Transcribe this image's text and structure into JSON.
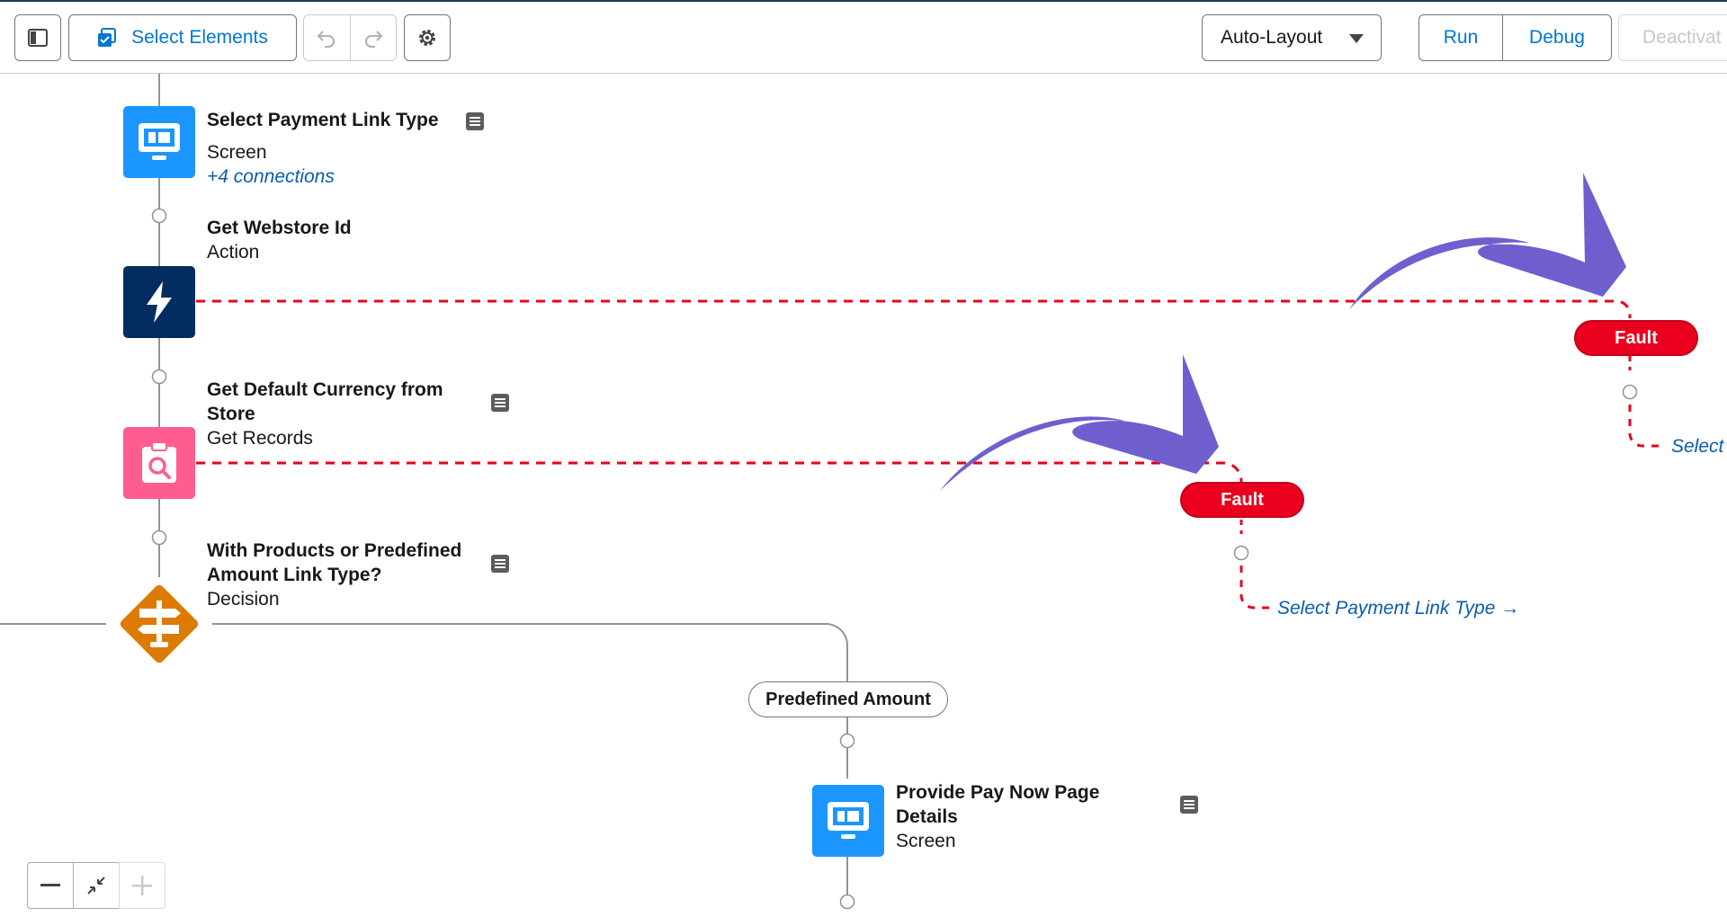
{
  "toolbar": {
    "select_elements_label": "Select Elements",
    "layout_select_value": "Auto-Layout",
    "run_label": "Run",
    "debug_label": "Debug",
    "deactivate_label": "Deactivat"
  },
  "nodes": [
    {
      "title": "Select Payment Link Type",
      "type": "Screen",
      "connections": "+4 connections"
    },
    {
      "title": "Get Webstore Id",
      "type": "Action"
    },
    {
      "title_lines": [
        "Get Default Currency from",
        "Store"
      ],
      "type": "Get Records"
    },
    {
      "title_lines": [
        "With Products or Predefined",
        "Amount Link Type?"
      ],
      "type": "Decision"
    },
    {
      "title_lines": [
        "Provide Pay Now Page",
        "Details"
      ],
      "type": "Screen"
    }
  ],
  "outcome_label": "Predefined Amount",
  "faults": [
    {
      "label": "Fault",
      "goto": "Select"
    },
    {
      "label": "Fault",
      "goto": "Select Payment Link Type →"
    }
  ],
  "colors": {
    "screen": "#1b96ff",
    "action": "#032d60",
    "get_records": "#ff5d8f",
    "decision": "#dd7a01",
    "fault": "#ea001e",
    "annotation_arrow": "#6f5fce",
    "brand_blue": "#0176d3"
  },
  "icons": {
    "panel_toggle": "panel-toggle-icon",
    "select_elements": "checkbox-select-icon",
    "undo": "undo-icon",
    "redo": "redo-icon",
    "settings": "gear-icon",
    "screen": "monitor-icon",
    "action": "lightning-icon",
    "get_records": "clipboard-search-icon",
    "decision": "signpost-icon",
    "description": "note-icon"
  }
}
